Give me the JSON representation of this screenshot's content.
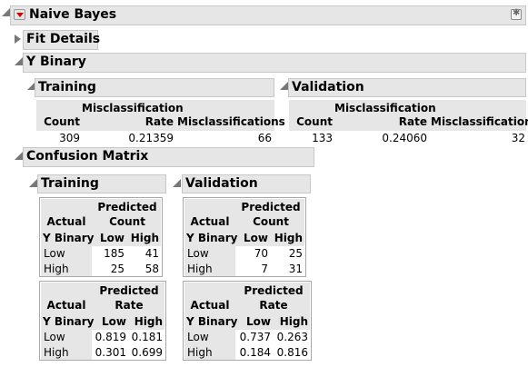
{
  "title": "Naive Bayes",
  "fit_details": "Fit Details",
  "y_binary": {
    "header": "Y Binary",
    "training": {
      "header": "Training",
      "col_count": "Count",
      "col_rate_1": "Misclassification",
      "col_rate_2": "Rate",
      "col_mis": "Misclassifications",
      "count": "309",
      "rate": "0.21359",
      "mis": "66"
    },
    "validation": {
      "header": "Validation",
      "col_count": "Count",
      "col_rate_1": "Misclassification",
      "col_rate_2": "Rate",
      "col_mis": "Misclassifications",
      "count": "133",
      "rate": "0.24060",
      "mis": "32"
    }
  },
  "confusion": {
    "header": "Confusion Matrix",
    "training": {
      "header": "Training",
      "count": {
        "predicted": "Predicted",
        "measure": "Count",
        "actual": "Actual",
        "var": "Y Binary",
        "col_low": "Low",
        "col_high": "High",
        "rows": [
          {
            "label": "Low",
            "low": "185",
            "high": "41"
          },
          {
            "label": "High",
            "low": "25",
            "high": "58"
          }
        ]
      },
      "rate": {
        "predicted": "Predicted",
        "measure": "Rate",
        "actual": "Actual",
        "var": "Y Binary",
        "col_low": "Low",
        "col_high": "High",
        "rows": [
          {
            "label": "Low",
            "low": "0.819",
            "high": "0.181"
          },
          {
            "label": "High",
            "low": "0.301",
            "high": "0.699"
          }
        ]
      }
    },
    "validation": {
      "header": "Validation",
      "count": {
        "predicted": "Predicted",
        "measure": "Count",
        "actual": "Actual",
        "var": "Y Binary",
        "col_low": "Low",
        "col_high": "High",
        "rows": [
          {
            "label": "Low",
            "low": "70",
            "high": "25"
          },
          {
            "label": "High",
            "low": "7",
            "high": "31"
          }
        ]
      },
      "rate": {
        "predicted": "Predicted",
        "measure": "Rate",
        "actual": "Actual",
        "var": "Y Binary",
        "col_low": "Low",
        "col_high": "High",
        "rows": [
          {
            "label": "Low",
            "low": "0.737",
            "high": "0.263"
          },
          {
            "label": "High",
            "low": "0.184",
            "high": "0.816"
          }
        ]
      }
    }
  }
}
